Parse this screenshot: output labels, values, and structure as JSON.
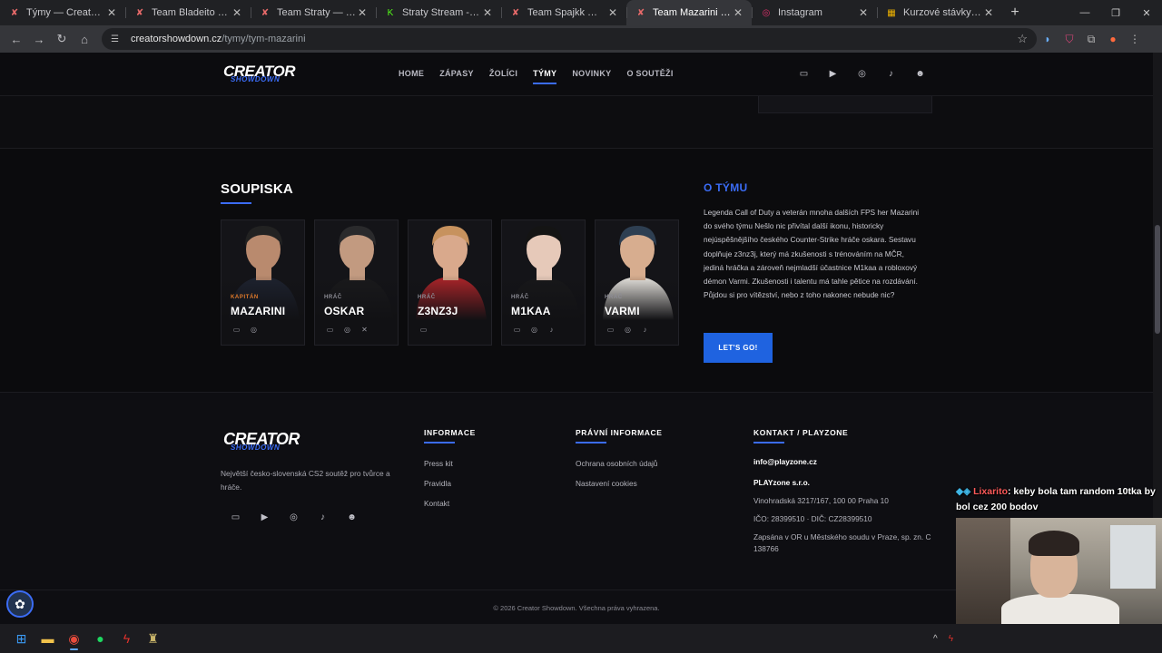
{
  "browser": {
    "tabs": [
      {
        "title": "Týmy — Creator Showdo",
        "icon": "creator-showdown-favicon",
        "active": false
      },
      {
        "title": "Team Bladeito — Creator",
        "icon": "creator-showdown-favicon",
        "active": false
      },
      {
        "title": "Team Straty — Creator Sh",
        "icon": "creator-showdown-favicon",
        "active": false
      },
      {
        "title": "Straty Stream - Watch Liv",
        "icon": "kick-favicon",
        "active": false
      },
      {
        "title": "Team Spajkk — Creator Sh",
        "icon": "creator-showdown-favicon",
        "active": false
      },
      {
        "title": "Team Mazarini — Creator",
        "icon": "creator-showdown-favicon",
        "active": true
      },
      {
        "title": "Instagram",
        "icon": "instagram-favicon",
        "active": false
      },
      {
        "title": "Kurzové stávky na Creato",
        "icon": "betting-favicon",
        "active": false
      }
    ],
    "url_host": "creatorshowdown.cz",
    "url_path": "/tymy/tym-mazarini"
  },
  "site": {
    "logo_line1": "CREATOR",
    "logo_line2": "SHOWDOWN",
    "nav": [
      {
        "label": "HOME",
        "active": false
      },
      {
        "label": "ZÁPASY",
        "active": false
      },
      {
        "label": "ŽOLÍCI",
        "active": false
      },
      {
        "label": "TÝMY",
        "active": true
      },
      {
        "label": "NOVINKY",
        "active": false
      },
      {
        "label": "O SOUTĚŽI",
        "active": false
      }
    ],
    "social_icons": [
      "twitch-icon",
      "youtube-icon",
      "instagram-icon",
      "tiktok-icon",
      "discord-icon"
    ]
  },
  "roster": {
    "title": "SOUPISKA",
    "players": [
      {
        "role": "KAPITÁN",
        "name": "MAZARINI",
        "captain": true,
        "links": [
          "twitch-icon",
          "instagram-icon"
        ],
        "skin": "#b98a6e",
        "shirt": "#1e2330",
        "hair": "#222"
      },
      {
        "role": "HRÁČ",
        "name": "OSKAR",
        "captain": false,
        "links": [
          "twitch-icon",
          "instagram-icon",
          "x-icon"
        ],
        "skin": "#c29a80",
        "shirt": "#1a1a1c",
        "hair": "#2a2a2c"
      },
      {
        "role": "HRÁČ",
        "name": "Z3NZ3J",
        "captain": false,
        "links": [
          "twitch-icon"
        ],
        "skin": "#d9a98c",
        "shirt": "#b0252a",
        "hair": "#c7925e"
      },
      {
        "role": "HRÁČ",
        "name": "M1KAA",
        "captain": false,
        "links": [
          "twitch-icon",
          "instagram-icon",
          "tiktok-icon"
        ],
        "skin": "#e6c9b9",
        "shirt": "#18181a",
        "hair": "#141414"
      },
      {
        "role": "HRÁČ",
        "name": "VARMI",
        "captain": false,
        "links": [
          "twitch-icon",
          "instagram-icon",
          "tiktok-icon"
        ],
        "skin": "#d7ad8f",
        "shirt": "#ece9e3",
        "hair": "#2e3f52"
      }
    ]
  },
  "about": {
    "title": "O TÝMU",
    "text": "Legenda Call of Duty a veterán mnoha dalších FPS her Mazarini do svého týmu Nešlo nic přivítal další ikonu, historicky nejúspěšnějšího českého Counter-Strike hráče oskara. Sestavu doplňuje z3nz3j, který má zkušenosti s trénováním na MČR, jediná hráčka a zároveň nejmladší účastnice M1kaa a robloxový démon Varmi. Zkušenosti i talentu má tahle pětice na rozdávání. Půjdou si pro vítězství, nebo z toho nakonec nebude nic?",
    "button": "LET'S GO!"
  },
  "footer": {
    "tagline": "Největší česko-slovenská CS2 soutěž pro tvůrce a hráče.",
    "informace": {
      "title": "INFORMACE",
      "links": [
        "Press kit",
        "Pravidla",
        "Kontakt"
      ]
    },
    "pravni": {
      "title": "PRÁVNÍ INFORMACE",
      "links": [
        "Ochrana osobních údajů",
        "Nastavení cookies"
      ]
    },
    "kontakt": {
      "title": "KONTAKT / PLAYZONE",
      "email": "info@playzone.cz",
      "company": "PLAYzone s.r.o.",
      "address": "Vinohradská 3217/167, 100 00 Praha 10",
      "ids": "IČO: 28399510 · DIČ: CZ28399510",
      "registry": "Zapsána v OR u Městského soudu v Praze, sp. zn. C 138766"
    },
    "copyright": "© 2026 Creator Showdown. Všechna práva vyhrazena."
  },
  "stream": {
    "chat_user": "Lixarito",
    "chat_message": ": keby bola tam random 10tka by bol cez 200 bodov"
  }
}
